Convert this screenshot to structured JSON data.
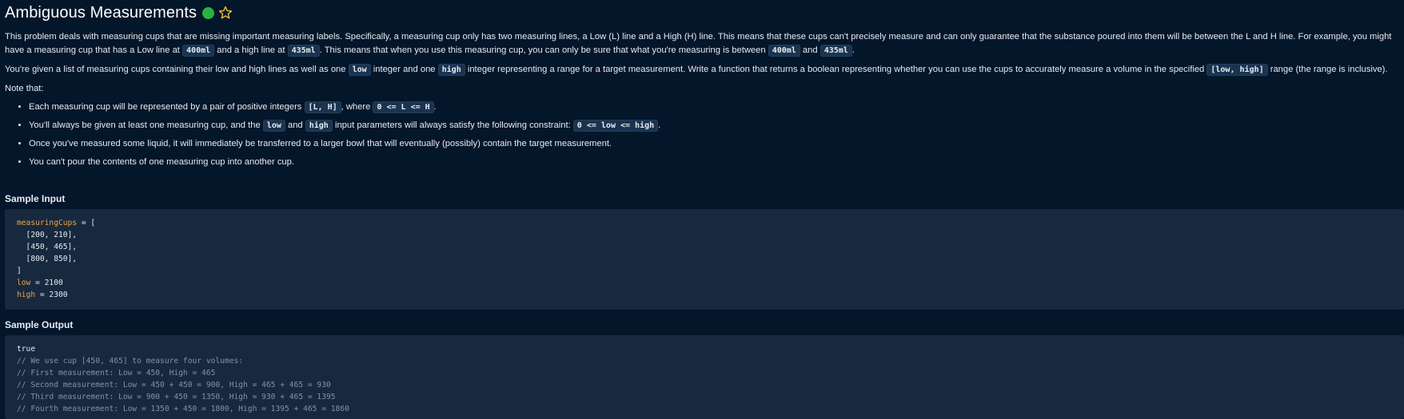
{
  "header": {
    "title": "Ambiguous Measurements",
    "status_color": "#27b340",
    "star_icon": "star-outline-icon"
  },
  "description": {
    "p1_a": "This problem deals with measuring cups that are missing important measuring labels. Specifically, a measuring cup only has two measuring lines, a Low (L) line and a High (H) line. This means that these cups can't precisely measure and can only guarantee that the substance poured into them will be between the L and H line. For example, you might have a measuring cup that has a Low line at ",
    "p1_code1": "400ml",
    "p1_b": " and a high line at ",
    "p1_code2": "435ml",
    "p1_c": ". This means that when you use this measuring cup, you can only be sure that what you're measuring is between ",
    "p1_code3": "400ml",
    "p1_d": " and ",
    "p1_code4": "435ml",
    "p1_e": ".",
    "p2_a": "You're given a list of measuring cups containing their low and high lines as well as one ",
    "p2_code1": "low",
    "p2_b": " integer and one ",
    "p2_code2": "high",
    "p2_c": " integer representing a range for a target measurement. Write a function that returns a boolean representing whether you can use the cups to accurately measure a volume in the specified ",
    "p2_code3": "[low, high]",
    "p2_d": " range (the range is inclusive).",
    "note": "Note that:",
    "li1_a": "Each measuring cup will be represented by a pair of positive integers ",
    "li1_code1": "[L, H]",
    "li1_b": ", where ",
    "li1_code2": "0 <= L <= H",
    "li1_c": ".",
    "li2_a": "You'll always be given at least one measuring cup, and the ",
    "li2_code1": "low",
    "li2_b": " and ",
    "li2_code2": "high",
    "li2_c": " input parameters will always satisfy the following constraint: ",
    "li2_code3": "0 <= low <= high",
    "li2_d": ".",
    "li3": "Once you've measured some liquid, it will immediately be transferred to a larger bowl that will eventually (possibly) contain the target measurement.",
    "li4": "You can't pour the contents of one measuring cup into another cup."
  },
  "sample_input": {
    "heading": "Sample Input",
    "var1": "measuringCups",
    "assign1": " = [",
    "row1": "  [200, 210],",
    "row2": "  [450, 465],",
    "row3": "  [800, 850],",
    "close": "]",
    "var2": "low",
    "assign2": " = 2100",
    "var3": "high",
    "assign3": " = 2300"
  },
  "sample_output": {
    "heading": "Sample Output",
    "result": "true",
    "c1": "// We use cup [450, 465] to measure four volumes:",
    "c2": "// First measurement: Low = 450, High = 465",
    "c3": "// Second measurement: Low = 450 + 450 = 900, High = 465 + 465 = 930",
    "c4": "// Third measurement: Low = 900 + 450 = 1350, High = 930 + 465 = 1395",
    "c5": "// Fourth measurement: Low = 1350 + 450 = 1800, High = 1395 + 465 = 1860"
  }
}
